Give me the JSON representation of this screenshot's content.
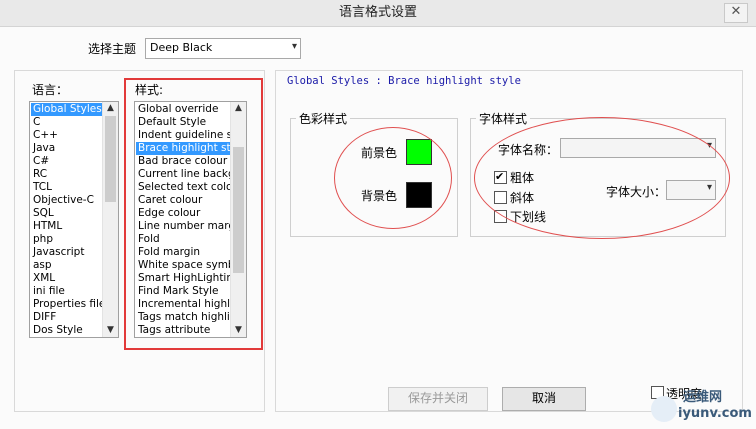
{
  "window": {
    "title": "语言格式设置",
    "close_glyph": "✕"
  },
  "theme": {
    "label": "选择主题",
    "selected": "Deep Black"
  },
  "language": {
    "label": "语言：",
    "items": [
      "Global Styles",
      "C",
      "C++",
      "Java",
      "C#",
      "RC",
      "TCL",
      "Objective-C",
      "SQL",
      "HTML",
      "php",
      "Javascript",
      "asp",
      "XML",
      "ini file",
      "Properties file",
      "DIFF",
      "Dos Style"
    ],
    "selected_index": 0
  },
  "styles": {
    "label": "样式:",
    "items": [
      "Global override",
      "Default Style",
      "Indent guideline sty",
      "Brace highlight style",
      "Bad brace colour",
      "Current line backgr",
      "Selected text colour",
      "Caret colour",
      "Edge colour",
      "Line number margin",
      "Fold",
      "Fold margin",
      "White space symbo",
      "Smart HighLighting",
      "Find Mark Style",
      "Incremental highligh",
      "Tags match highligh",
      "Tags attribute"
    ],
    "selected_index": 3
  },
  "style_header": "Global Styles : Brace highlight style",
  "color_style": {
    "title": "色彩样式",
    "foreground_label": "前景色",
    "background_label": "背景色",
    "foreground_color": "#00ff00",
    "background_color": "#000000"
  },
  "font_style": {
    "title": "字体样式",
    "font_name_label": "字体名称：",
    "font_name_value": "",
    "bold_label": "粗体",
    "bold_checked": true,
    "italic_label": "斜体",
    "italic_checked": false,
    "underline_label": "下划线",
    "underline_checked": false,
    "font_size_label": "字体大小：",
    "font_size_value": ""
  },
  "buttons": {
    "save_close": "保存并关闭",
    "cancel": "取消"
  },
  "transparency": {
    "label": "透明度",
    "checked": false
  },
  "watermark": {
    "text_top": "运维网",
    "text_bottom": "iyunv.com"
  },
  "annotation_color": "#e23a3a"
}
